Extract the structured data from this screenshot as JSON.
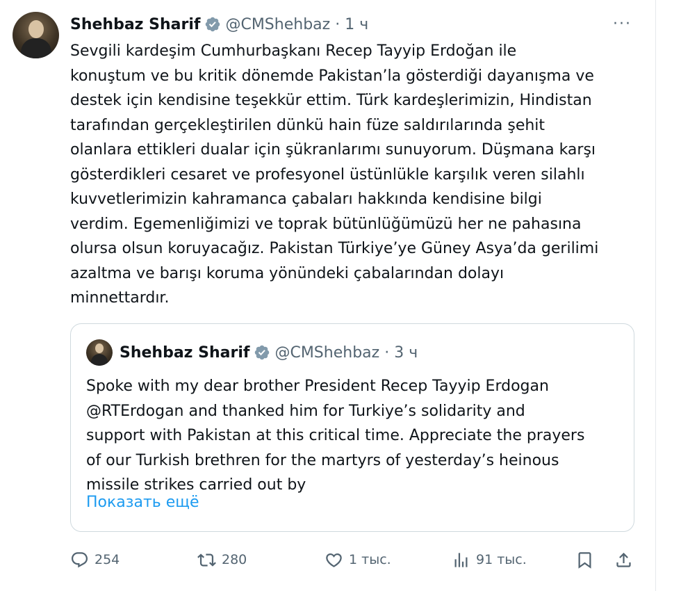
{
  "tweet": {
    "author_name": "Shehbaz Sharif",
    "handle": "@CMShehbaz",
    "separator": "·",
    "time": "1 ч",
    "more_label": "···",
    "text": "Sevgili kardeşim Cumhurbaşkanı Recep Tayyip Erdoğan ile\nkonuştum ve bu kritik dönemde Pakistan’la gösterdiği dayanışma ve\ndestek için kendisine teşekkür ettim. Türk kardeşlerimizin, Hindistan\ntarafından gerçekleştirilen dünkü hain füze saldırılarında şehit\nolanlara ettikleri dualar için şükranlarımı sunuyorum. Düşmana karşı\ngösterdikleri cesaret ve profesyonel üstünlükle karşılık veren silahlı\nkuvvetlerimizin kahramanca çabaları hakkında kendisine bilgi\nverdim. Egemenliğimizi ve toprak bütünlüğümüzü her ne pahasına\nolursa olsun koruyacağız. Pakistan Türkiye’ye Güney Asya’da gerilimi\nazaltma ve barışı koruma yönündeki çabalarından dolayı\nminnettardır."
  },
  "quote": {
    "author_name": "Shehbaz Sharif",
    "handle": "@CMShehbaz",
    "separator": "·",
    "time": "3 ч",
    "text": "Spoke with my dear brother President Recep Tayyip Erdogan\n@RTErdogan and thanked him for Turkiye’s solidarity and\nsupport with Pakistan at this critical time. Appreciate the prayers\nof our Turkish brethren for the martyrs of yesterday’s heinous\nmissile strikes carried out by",
    "show_more": "Показать ещё"
  },
  "actions": {
    "replies": "254",
    "reposts": "280",
    "likes": "1 тыс.",
    "views": "91 тыс."
  },
  "colors": {
    "text": "#0f1419",
    "secondary": "#536471",
    "link": "#1d9bf0",
    "verified": "#829aab",
    "border": "#cfd9de"
  }
}
